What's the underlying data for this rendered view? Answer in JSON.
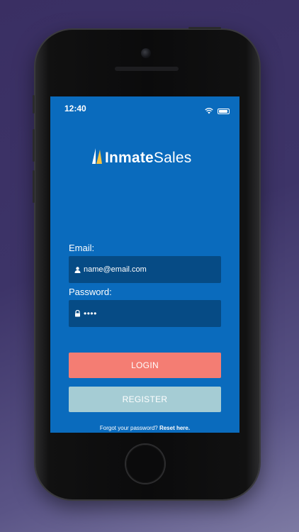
{
  "status_bar": {
    "time": "12:40"
  },
  "logo": {
    "part1": "Inmate",
    "part2": "Sales"
  },
  "form": {
    "email_label": "Email:",
    "email_value": "name@email.com",
    "password_label": "Password:",
    "password_value": "••••"
  },
  "buttons": {
    "login": "LOGIN",
    "register": "REGISTER"
  },
  "forgot": {
    "text": "Forgot your password? ",
    "link": "Reset here."
  },
  "colors": {
    "screen_bg": "#0a6bbd",
    "input_bg": "#064b85",
    "login_btn": "#f47d73",
    "register_btn": "#a5ccd4"
  },
  "icons": {
    "user": "user-icon",
    "lock": "lock-icon",
    "wifi": "wifi-icon",
    "battery": "battery-icon",
    "sail": "sail-logo-icon"
  }
}
